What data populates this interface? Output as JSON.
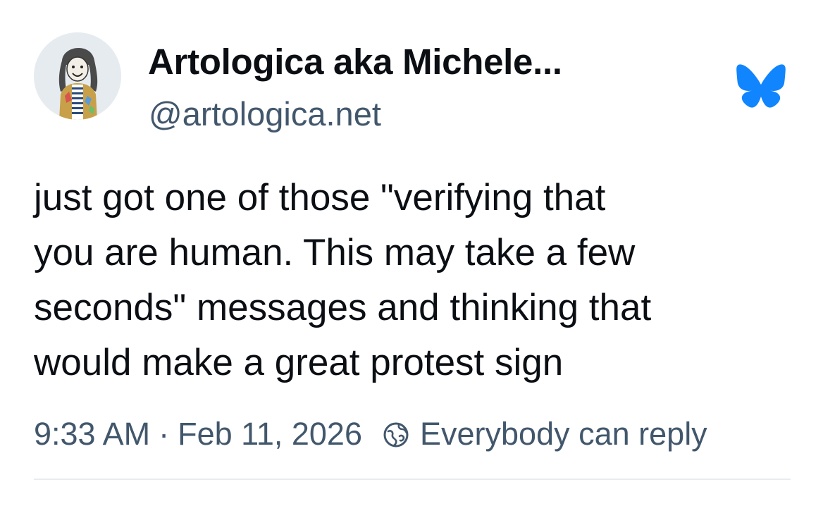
{
  "author": {
    "display_name": "Artologica aka Michele...",
    "handle": "@artologica.net",
    "avatar_icon": "cartoon-girl-avatar"
  },
  "app_logo": {
    "icon": "bluesky-butterfly-icon",
    "color": "#1185fe"
  },
  "post": {
    "lines": [
      "just got one of those \"verifying that",
      "you are human. This may take a few",
      "seconds\" messages and thinking that",
      "would make a great protest sign"
    ]
  },
  "meta": {
    "time": "9:33 AM",
    "separator": "·",
    "date": "Feb 11, 2026",
    "reply_icon": "globe-reply-icon",
    "reply_setting": "Everybody can reply"
  },
  "colors": {
    "text": "#0b0f14",
    "secondary": "#42576c",
    "divider": "#e8ecf0"
  }
}
